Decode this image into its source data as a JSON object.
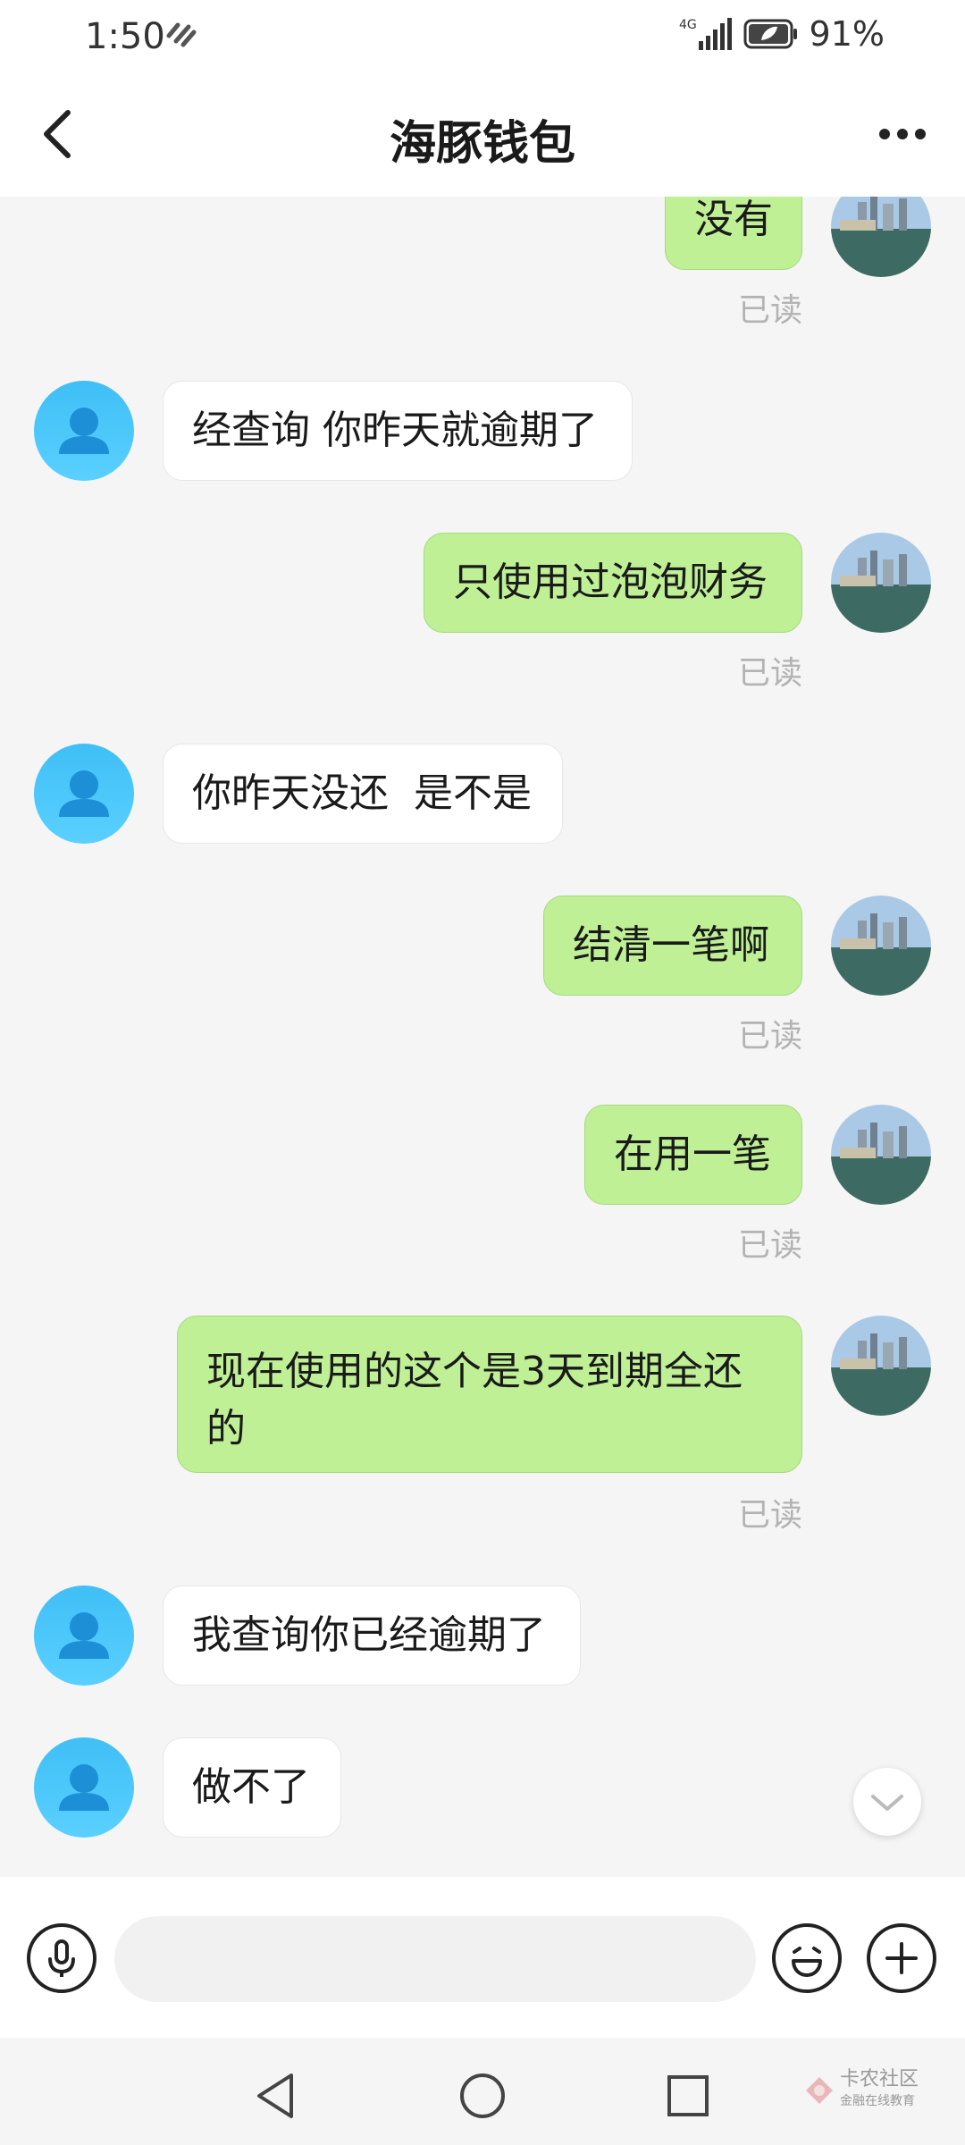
{
  "status_bar": {
    "time": "1:50",
    "network": "4G",
    "battery": "91%"
  },
  "header": {
    "title": "海豚钱包"
  },
  "messages": [
    {
      "side": "right",
      "text": "没有",
      "read": "已读"
    },
    {
      "side": "left",
      "text": "经查询 你昨天就逾期了"
    },
    {
      "side": "right",
      "text": "只使用过泡泡财务",
      "read": "已读"
    },
    {
      "side": "left",
      "text": "你昨天没还  是不是"
    },
    {
      "side": "right",
      "text": "结清一笔啊",
      "read": "已读"
    },
    {
      "side": "right",
      "text": "在用一笔",
      "read": "已读"
    },
    {
      "side": "right",
      "text_line1": "现在使用的这个是3天到期全还",
      "text_line2": "的",
      "read": "已读"
    },
    {
      "side": "left",
      "text": "我查询你已经逾期了"
    },
    {
      "side": "left",
      "text": "做不了"
    }
  ],
  "input": {
    "value": "",
    "placeholder": ""
  },
  "watermark": {
    "line1": "卡农社区",
    "line2": "金融在线教育"
  },
  "icons": {
    "back": "back-arrow-icon",
    "more": "more-dots-icon",
    "mic": "microphone-icon",
    "emoji": "smiley-icon",
    "plus": "plus-icon",
    "scroll": "chevron-down-icon"
  },
  "colors": {
    "self_bubble": "#bff096",
    "other_bubble": "#ffffff",
    "avatar_blue": "#3fbff6"
  }
}
